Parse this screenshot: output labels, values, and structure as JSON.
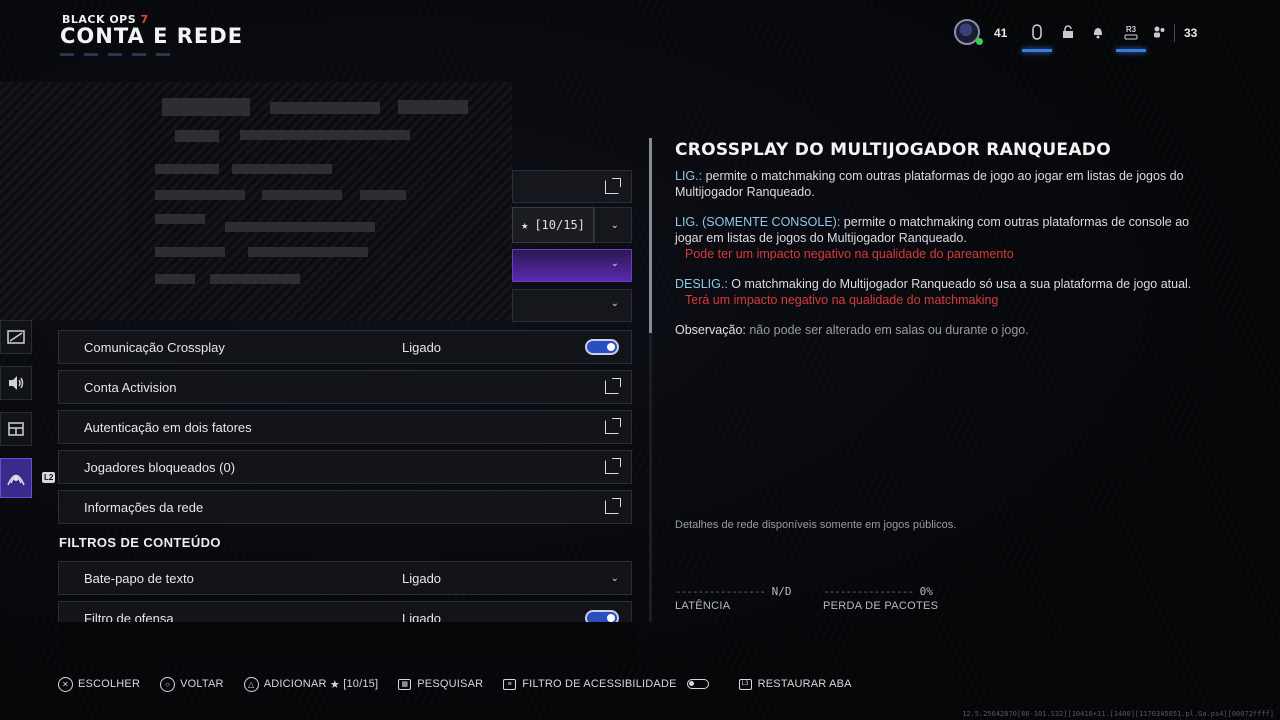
{
  "header": {
    "game_logo": "BLACK OPS",
    "game_logo_num": "7",
    "title": "CONTA E REDE"
  },
  "topbar": {
    "level": "41",
    "r3_label": "R3",
    "count": "33"
  },
  "favorite_counter": "[10/15]",
  "side_nav": [
    "graphics-icon",
    "audio-icon",
    "interface-icon",
    "account-network-icon"
  ],
  "settings": {
    "rows": [
      {
        "label": "Comunicação Crossplay",
        "value": "Ligado",
        "control": "toggle"
      },
      {
        "label": "Conta Activision",
        "control": "external"
      },
      {
        "label": "Autenticação em dois fatores",
        "control": "external"
      },
      {
        "label": "Jogadores bloqueados (0)",
        "control": "external"
      },
      {
        "label": "Informações da rede",
        "control": "external"
      }
    ],
    "content_filters_heading": "FILTROS DE CONTEÚDO",
    "filter_rows": [
      {
        "label": "Bate-papo de texto",
        "value": "Ligado",
        "control": "dropdown"
      },
      {
        "label": "Filtro de ofensa",
        "value": "Ligado",
        "control": "toggle"
      }
    ]
  },
  "description": {
    "title": "CROSSPLAY DO MULTIJOGADOR RANQUEADO",
    "on_key": "LIG.:",
    "on_text": " permite o matchmaking com outras plataformas de jogo ao jogar em listas de jogos do Multijogador Ranqueado.",
    "console_key": "LIG. (SOMENTE CONSOLE):",
    "console_text": " permite o matchmaking com outras plataformas de console ao jogar em listas de jogos do Multijogador Ranqueado.",
    "console_warn": "Pode ter um impacto negativo na qualidade do pareamento",
    "off_key": "DESLIG.:",
    "off_text": " O matchmaking do Multijogador Ranqueado só usa a sua plataforma de jogo atual.",
    "off_warn": "Terá um impacto negativo na qualidade do matchmaking",
    "obs_key": "Observação:",
    "obs_text": " não pode ser alterado em salas ou durante o jogo."
  },
  "network": {
    "note": "Detalhes de rede disponíveis somente em jogos públicos.",
    "latency_value": "N/D",
    "latency_label": "LATÊNCIA",
    "packet_loss_value": "0%",
    "packet_loss_label": "PERDA DE PACOTES"
  },
  "footer": {
    "choose": "ESCOLHER",
    "back": "VOLTAR",
    "add": "ADICIONAR",
    "add_count": "[10/15]",
    "search": "PESQUISAR",
    "accessibility": "FILTRO DE ACESSIBILIDADE",
    "restore": "RESTAURAR ABA",
    "l3": "L3"
  },
  "build_string": "12.5.25642870[86-101.132][10416+11.[1400][1170345051.pl.Ga.ps4][00072ffff]"
}
